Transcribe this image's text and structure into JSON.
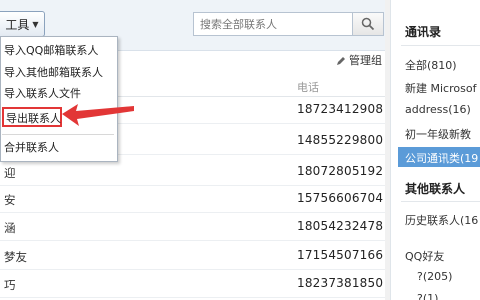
{
  "toolbar": {
    "tools_label": "工具"
  },
  "search": {
    "placeholder": "搜索全部联系人"
  },
  "manage_label": "管理组",
  "column_phone": "电话",
  "contacts": [
    {
      "name": "",
      "phone": "18723412908"
    },
    {
      "name": "",
      "phone": "14855229800"
    },
    {
      "name": "迎",
      "phone": "18072805192"
    },
    {
      "name": "安",
      "phone": "15756606704"
    },
    {
      "name": "涵",
      "phone": "18054232478"
    },
    {
      "name": "梦友",
      "phone": "17154507166"
    },
    {
      "name": "巧",
      "phone": "18237381850"
    }
  ],
  "tools_menu": [
    "导入QQ邮箱联系人",
    "导入其他邮箱联系人",
    "导入联系人文件",
    "导出联系人",
    "合并联系人"
  ],
  "sidebar": {
    "address_book_title": "通讯录",
    "groups": [
      "全部(810)",
      "新建 Microsof",
      "address(16)",
      "初一年级新教",
      "公司通讯类(19"
    ],
    "other_title": "其他联系人",
    "history": "历史联系人(16",
    "qq_friends": "QQ好友",
    "qq_group1": "?(205)",
    "qq_group2": "?(1)"
  },
  "colors": {
    "highlight": "#e23636",
    "selected_bg": "#5b9bd8"
  }
}
